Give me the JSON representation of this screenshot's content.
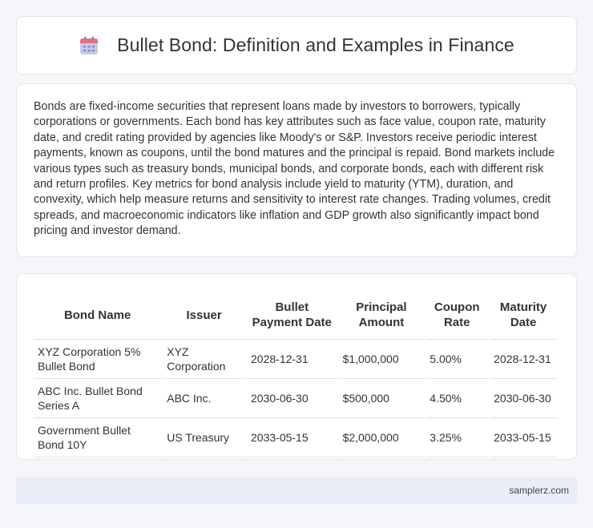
{
  "header": {
    "icon": "calendar-icon",
    "title": "Bullet Bond: Definition and Examples in Finance"
  },
  "intro": {
    "text": "Bonds are fixed-income securities that represent loans made by investors to borrowers, typically corporations or governments. Each bond has key attributes such as face value, coupon rate, maturity date, and credit rating provided by agencies like Moody's or S&P. Investors receive periodic interest payments, known as coupons, until the bond matures and the principal is repaid. Bond markets include various types such as treasury bonds, municipal bonds, and corporate bonds, each with different risk and return profiles. Key metrics for bond analysis include yield to maturity (YTM), duration, and convexity, which help measure returns and sensitivity to interest rate changes. Trading volumes, credit spreads, and macroeconomic indicators like inflation and GDP growth also significantly impact bond pricing and investor demand."
  },
  "table": {
    "headers": [
      "Bond Name",
      "Issuer",
      "Bullet Payment Date",
      "Principal Amount",
      "Coupon Rate",
      "Maturity Date"
    ],
    "rows": [
      [
        "XYZ Corporation 5% Bullet Bond",
        "XYZ Corporation",
        "2028-12-31",
        "$1,000,000",
        "5.00%",
        "2028-12-31"
      ],
      [
        "ABC Inc. Bullet Bond Series A",
        "ABC Inc.",
        "2030-06-30",
        "$500,000",
        "4.50%",
        "2030-06-30"
      ],
      [
        "Government Bullet Bond 10Y",
        "US Treasury",
        "2033-05-15",
        "$2,000,000",
        "3.25%",
        "2033-05-15"
      ]
    ]
  },
  "footer": {
    "text": "samplerz.com"
  },
  "colors": {
    "calendar_top": "#e57373",
    "calendar_body": "#c5cae9",
    "calendar_grid": "#7986cb"
  }
}
